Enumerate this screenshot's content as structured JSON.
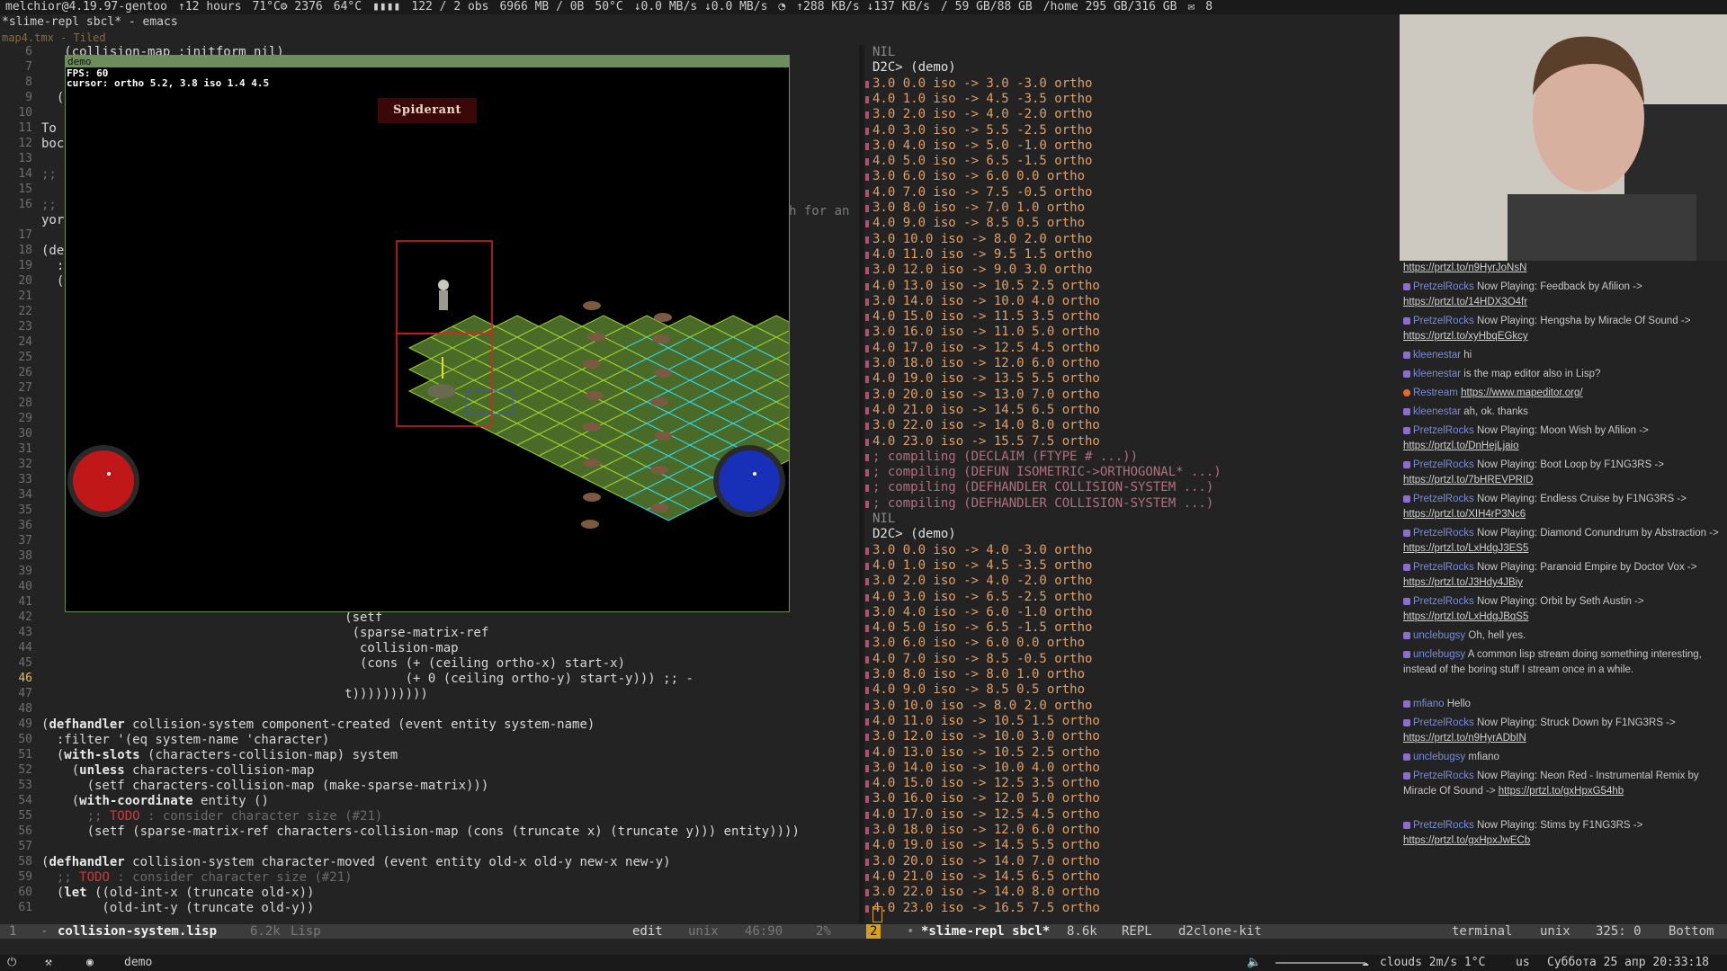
{
  "topbar": {
    "host": "melchior@4.19.97-gentoo",
    "uptime": "↑12 hours",
    "cpu_temp": "71°C⚙ 2376",
    "gpu_temp": "64°C",
    "load": "122 / 2 obs",
    "mem": "6966 MB / 0B",
    "disk_temp": "50°C",
    "io": "↓0.0 MB/s ↓0.0 MB/s",
    "net": "↑288 KB/s ↓137 KB/s",
    "root": "/ 59 GB/88 GB",
    "home": "/home 295 GB/316 GB",
    "mail_count": "8"
  },
  "window_title": "*slime-repl sbcl* - emacs",
  "tiled_label": "map4.tmx - Tiled",
  "editor": {
    "lines": [
      {
        "n": "6",
        "t": "   (collision-map :initform nil)"
      },
      {
        "n": "7",
        "t": ""
      },
      {
        "n": "8",
        "t": ""
      },
      {
        "n": "9",
        "t": "  ("
      },
      {
        "n": "10",
        "t": ""
      },
      {
        "n": "11",
        "t": "To"
      },
      {
        "n": "12",
        "t": "boc"
      },
      {
        "n": "13",
        "t": ""
      },
      {
        "n": "14",
        "t": ";;"
      },
      {
        "n": "15",
        "t": ""
      },
      {
        "n": "16",
        "t": ";;"
      },
      {
        "n": "",
        "t": "yor"
      },
      {
        "n": "17",
        "t": ""
      },
      {
        "n": "18",
        "t": "(de"
      },
      {
        "n": "19",
        "t": "  :"
      },
      {
        "n": "20",
        "t": "  ("
      },
      {
        "n": "21",
        "t": ""
      },
      {
        "n": "22",
        "t": ""
      },
      {
        "n": "23",
        "t": ""
      },
      {
        "n": "24",
        "t": ""
      },
      {
        "n": "25",
        "t": ""
      },
      {
        "n": "26",
        "t": ""
      },
      {
        "n": "27",
        "t": ""
      },
      {
        "n": "28",
        "t": ""
      },
      {
        "n": "29",
        "t": ""
      },
      {
        "n": "30",
        "t": ""
      },
      {
        "n": "31",
        "t": ""
      },
      {
        "n": "32",
        "t": ""
      },
      {
        "n": "33",
        "t": ""
      },
      {
        "n": "34",
        "t": ""
      },
      {
        "n": "35",
        "t": ""
      },
      {
        "n": "36",
        "t": ""
      },
      {
        "n": "37",
        "t": ""
      },
      {
        "n": "38",
        "t": ""
      },
      {
        "n": "39",
        "t": ""
      },
      {
        "n": "40",
        "t": ""
      },
      {
        "n": "41",
        "t": ""
      },
      {
        "n": "42",
        "t": "                                        (setf"
      },
      {
        "n": "43",
        "t": "                                         (sparse-matrix-ref"
      },
      {
        "n": "44",
        "t": "                                          collision-map"
      },
      {
        "n": "45",
        "t": "                                          (cons (+ (ceiling ortho-x) start-x)"
      },
      {
        "n": "46",
        "t": "                                                (+ 0 (ceiling ortho-y) start-y))) ;; -"
      },
      {
        "n": "47",
        "t": "                                        t))))))))))"
      },
      {
        "n": "48",
        "t": ""
      },
      {
        "n": "49",
        "t": "(defhandler collision-system component-created (event entity system-name)"
      },
      {
        "n": "50",
        "t": "  :filter '(eq system-name 'character)"
      },
      {
        "n": "51",
        "t": "  (with-slots (characters-collision-map) system"
      },
      {
        "n": "52",
        "t": "    (unless characters-collision-map"
      },
      {
        "n": "53",
        "t": "      (setf characters-collision-map (make-sparse-matrix)))"
      },
      {
        "n": "54",
        "t": "    (with-coordinate entity ()"
      },
      {
        "n": "55",
        "t": "      ;; TODO : consider character size (#21)"
      },
      {
        "n": "56",
        "t": "      (setf (sparse-matrix-ref characters-collision-map (cons (truncate x) (truncate y))) entity))))"
      },
      {
        "n": "57",
        "t": ""
      },
      {
        "n": "58",
        "t": "(defhandler collision-system character-moved (event entity old-x old-y new-x new-y)"
      },
      {
        "n": "59",
        "t": "  ;; TODO : consider character size (#21)"
      },
      {
        "n": "60",
        "t": "  (let ((old-int-x (truncate old-x))"
      },
      {
        "n": "61",
        "t": "        (old-int-y (truncate old-y))"
      }
    ],
    "fragment_right": "h for an"
  },
  "demo": {
    "title": "demo",
    "fps": "FPS: 60",
    "cursor": "cursor: ortho 5.2, 3.8 iso 1.4 4.5",
    "target": "Spiderant"
  },
  "repl": {
    "lines": [
      {
        "k": "nil",
        "t": "NIL"
      },
      {
        "k": "prompt",
        "t": "D2C> (demo)"
      },
      {
        "k": "o",
        "t": "3.0 0.0 iso -> 3.0 -3.0 ortho"
      },
      {
        "k": "o",
        "t": "4.0 1.0 iso -> 4.5 -3.5 ortho"
      },
      {
        "k": "o",
        "t": "3.0 2.0 iso -> 4.0 -2.0 ortho"
      },
      {
        "k": "o",
        "t": "4.0 3.0 iso -> 5.5 -2.5 ortho"
      },
      {
        "k": "o",
        "t": "3.0 4.0 iso -> 5.0 -1.0 ortho"
      },
      {
        "k": "o",
        "t": "4.0 5.0 iso -> 6.5 -1.5 ortho"
      },
      {
        "k": "o",
        "t": "3.0 6.0 iso -> 6.0 0.0 ortho"
      },
      {
        "k": "o",
        "t": "4.0 7.0 iso -> 7.5 -0.5 ortho"
      },
      {
        "k": "o",
        "t": "3.0 8.0 iso -> 7.0 1.0 ortho"
      },
      {
        "k": "o",
        "t": "4.0 9.0 iso -> 8.5 0.5 ortho"
      },
      {
        "k": "o",
        "t": "3.0 10.0 iso -> 8.0 2.0 ortho"
      },
      {
        "k": "o",
        "t": "4.0 11.0 iso -> 9.5 1.5 ortho"
      },
      {
        "k": "o",
        "t": "3.0 12.0 iso -> 9.0 3.0 ortho"
      },
      {
        "k": "o",
        "t": "4.0 13.0 iso -> 10.5 2.5 ortho"
      },
      {
        "k": "o",
        "t": "3.0 14.0 iso -> 10.0 4.0 ortho"
      },
      {
        "k": "o",
        "t": "4.0 15.0 iso -> 11.5 3.5 ortho"
      },
      {
        "k": "o",
        "t": "3.0 16.0 iso -> 11.0 5.0 ortho"
      },
      {
        "k": "o",
        "t": "4.0 17.0 iso -> 12.5 4.5 ortho"
      },
      {
        "k": "o",
        "t": "3.0 18.0 iso -> 12.0 6.0 ortho"
      },
      {
        "k": "o",
        "t": "4.0 19.0 iso -> 13.5 5.5 ortho"
      },
      {
        "k": "o",
        "t": "3.0 20.0 iso -> 13.0 7.0 ortho"
      },
      {
        "k": "o",
        "t": "4.0 21.0 iso -> 14.5 6.5 ortho"
      },
      {
        "k": "o",
        "t": "3.0 22.0 iso -> 14.0 8.0 ortho"
      },
      {
        "k": "o",
        "t": "4.0 23.0 iso -> 15.5 7.5 ortho"
      },
      {
        "k": "c",
        "t": "; compiling (DECLAIM (FTYPE # ...))"
      },
      {
        "k": "c",
        "t": "; compiling (DEFUN ISOMETRIC->ORTHOGONAL* ...)"
      },
      {
        "k": "c",
        "t": "; compiling (DEFHANDLER COLLISION-SYSTEM ...)"
      },
      {
        "k": "c",
        "t": "; compiling (DEFHANDLER COLLISION-SYSTEM ...)"
      },
      {
        "k": "nil",
        "t": "NIL"
      },
      {
        "k": "prompt",
        "t": "D2C> (demo)"
      },
      {
        "k": "o",
        "t": "3.0 0.0 iso -> 4.0 -3.0 ortho"
      },
      {
        "k": "o",
        "t": "4.0 1.0 iso -> 4.5 -3.5 ortho"
      },
      {
        "k": "o",
        "t": "3.0 2.0 iso -> 4.0 -2.0 ortho"
      },
      {
        "k": "o",
        "t": "4.0 3.0 iso -> 6.5 -2.5 ortho"
      },
      {
        "k": "o",
        "t": "3.0 4.0 iso -> 6.0 -1.0 ortho"
      },
      {
        "k": "o",
        "t": "4.0 5.0 iso -> 6.5 -1.5 ortho"
      },
      {
        "k": "o",
        "t": "3.0 6.0 iso -> 6.0 0.0 ortho"
      },
      {
        "k": "o",
        "t": "4.0 7.0 iso -> 8.5 -0.5 ortho"
      },
      {
        "k": "o",
        "t": "3.0 8.0 iso -> 8.0 1.0 ortho"
      },
      {
        "k": "o",
        "t": "4.0 9.0 iso -> 8.5 0.5 ortho"
      },
      {
        "k": "o",
        "t": "3.0 10.0 iso -> 8.0 2.0 ortho"
      },
      {
        "k": "o",
        "t": "4.0 11.0 iso -> 10.5 1.5 ortho"
      },
      {
        "k": "o",
        "t": "3.0 12.0 iso -> 10.0 3.0 ortho"
      },
      {
        "k": "o",
        "t": "4.0 13.0 iso -> 10.5 2.5 ortho"
      },
      {
        "k": "o",
        "t": "3.0 14.0 iso -> 10.0 4.0 ortho"
      },
      {
        "k": "o",
        "t": "4.0 15.0 iso -> 12.5 3.5 ortho"
      },
      {
        "k": "o",
        "t": "3.0 16.0 iso -> 12.0 5.0 ortho"
      },
      {
        "k": "o",
        "t": "4.0 17.0 iso -> 12.5 4.5 ortho"
      },
      {
        "k": "o",
        "t": "3.0 18.0 iso -> 12.0 6.0 ortho"
      },
      {
        "k": "o",
        "t": "4.0 19.0 iso -> 14.5 5.5 ortho"
      },
      {
        "k": "o",
        "t": "3.0 20.0 iso -> 14.0 7.0 ortho"
      },
      {
        "k": "o",
        "t": "4.0 21.0 iso -> 14.5 6.5 ortho"
      },
      {
        "k": "o",
        "t": "3.0 22.0 iso -> 14.0 8.0 ortho"
      },
      {
        "k": "o",
        "t": "4.0 23.0 iso -> 16.5 7.5 ortho"
      }
    ]
  },
  "chat": {
    "messages": [
      {
        "u": "",
        "t": "",
        "a": "https://prtzl.to/n9HyrJoNsN",
        "b": ""
      },
      {
        "u": "PretzelRocks",
        "t": " Now Playing: Feedback by Afilion -> ",
        "a": "https://prtzl.to/14HDX3O4fr",
        "b": "p"
      },
      {
        "u": "PretzelRocks",
        "t": " Now Playing: Hengsha by Miracle Of Sound -> ",
        "a": "https://prtzl.to/xyHbqEGkcy",
        "b": "p"
      },
      {
        "u": "kleenestar",
        "t": " hi",
        "a": "",
        "b": "p"
      },
      {
        "u": "kleenestar",
        "t": " is the map editor also in Lisp?",
        "a": "",
        "b": "p"
      },
      {
        "u": "Restream",
        "t": " ",
        "a": "https://www.mapeditor.org/",
        "b": "r"
      },
      {
        "u": "kleenestar",
        "t": " ah, ok. thanks",
        "a": "",
        "b": "p"
      },
      {
        "u": "PretzelRocks",
        "t": " Now Playing: Moon Wish by Afilion -> ",
        "a": "https://prtzl.to/DnHejLjaio",
        "b": "p"
      },
      {
        "u": "PretzelRocks",
        "t": " Now Playing: Boot Loop by F1NG3RS -> ",
        "a": "https://prtzl.to/7bHREVPRID",
        "b": "p"
      },
      {
        "u": "PretzelRocks",
        "t": " Now Playing: Endless Cruise by F1NG3RS -> ",
        "a": "https://prtzl.to/XIH4rP3Nc6",
        "b": "p"
      },
      {
        "u": "PretzelRocks",
        "t": " Now Playing: Diamond Conundrum by Abstraction -> ",
        "a": "https://prtzl.to/LxHdgJ3ES5",
        "b": "p"
      },
      {
        "u": "PretzelRocks",
        "t": " Now Playing: Paranoid Empire by Doctor Vox -> ",
        "a": "https://prtzl.to/J3Hdy4JBiy",
        "b": "p"
      },
      {
        "u": "PretzelRocks",
        "t": " Now Playing: Orbit by Seth Austin -> ",
        "a": "https://prtzl.to/LxHdgJBqS5",
        "b": "p"
      },
      {
        "u": "unclebugsy",
        "t": " Oh, hell yes.",
        "a": "",
        "b": "p"
      },
      {
        "u": "unclebugsy",
        "t": " A common lisp stream doing something interesting, instead of the boring stuff I stream once in a while.",
        "a": "",
        "b": "p"
      },
      {
        "u": "mfiano",
        "t": " Hello",
        "a": "",
        "b": "p"
      },
      {
        "u": "PretzelRocks",
        "t": " Now Playing: Struck Down by F1NG3RS -> ",
        "a": "https://prtzl.to/n9HyrADbIN",
        "b": "p"
      },
      {
        "u": "unclebugsy",
        "t": " mfiano",
        "a": "",
        "b": "p"
      },
      {
        "u": "PretzelRocks",
        "t": " Now Playing: Neon Red - Instrumental Remix by Miracle Of Sound -> ",
        "a": "https://prtzl.to/gxHpxG54hb",
        "b": "p"
      },
      {
        "u": "PretzelRocks",
        "t": " Now Playing: Stims by F1NG3RS -> ",
        "a": "https://prtzl.to/gxHpxJwECb",
        "b": "p"
      }
    ]
  },
  "modeline": {
    "left_num": "1",
    "buffer": "collision-system.lisp",
    "size": "6.2k",
    "mode": "Lisp",
    "state": "edit",
    "encoding": "unix",
    "position": "46:90",
    "percent": "2%",
    "repl_num": "2",
    "repl_buffer": "*slime-repl sbcl*",
    "repl_size": "8.6k",
    "repl_mode": "REPL",
    "repl_project": "d2clone-kit",
    "term_label": "terminal",
    "term_enc": "unix",
    "term_pos": "325: 0",
    "term_where": "Bottom"
  },
  "bottombar": {
    "workspace": "demo",
    "weather": "clouds 2m/s 1°C",
    "layout": "us",
    "datetime": "Суббота 25 апр 20:33:18"
  },
  "colors": {
    "grass": "#4a6a28",
    "grid_green": "#9ad030",
    "grid_cyan": "#30d8e8",
    "hp": "#c01818",
    "mana": "#1830b8",
    "selection": "#e02020"
  }
}
